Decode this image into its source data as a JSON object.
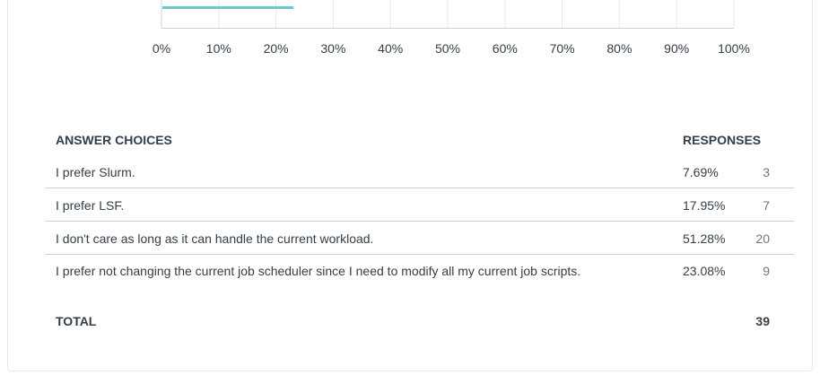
{
  "chart_data": {
    "type": "bar",
    "orientation": "horizontal",
    "visible_bar_value": 23.08,
    "bar_color": "#6bc8cd",
    "grid": true,
    "xlim": [
      0,
      100
    ],
    "x_ticks": [
      "0%",
      "10%",
      "20%",
      "30%",
      "40%",
      "50%",
      "60%",
      "70%",
      "80%",
      "90%",
      "100%"
    ]
  },
  "table": {
    "header_choices": "ANSWER CHOICES",
    "header_responses": "RESPONSES",
    "rows": [
      {
        "choice": "I prefer Slurm.",
        "percent": "7.69%",
        "count": "3"
      },
      {
        "choice": "I prefer LSF.",
        "percent": "17.95%",
        "count": "7"
      },
      {
        "choice": "I don't care as long as it can handle the current workload.",
        "percent": "51.28%",
        "count": "20"
      },
      {
        "choice": "I prefer not changing the current job scheduler since I need to modify all my current job scripts.",
        "percent": "23.08%",
        "count": "9"
      }
    ],
    "total_label": "TOTAL",
    "total_value": "39"
  }
}
